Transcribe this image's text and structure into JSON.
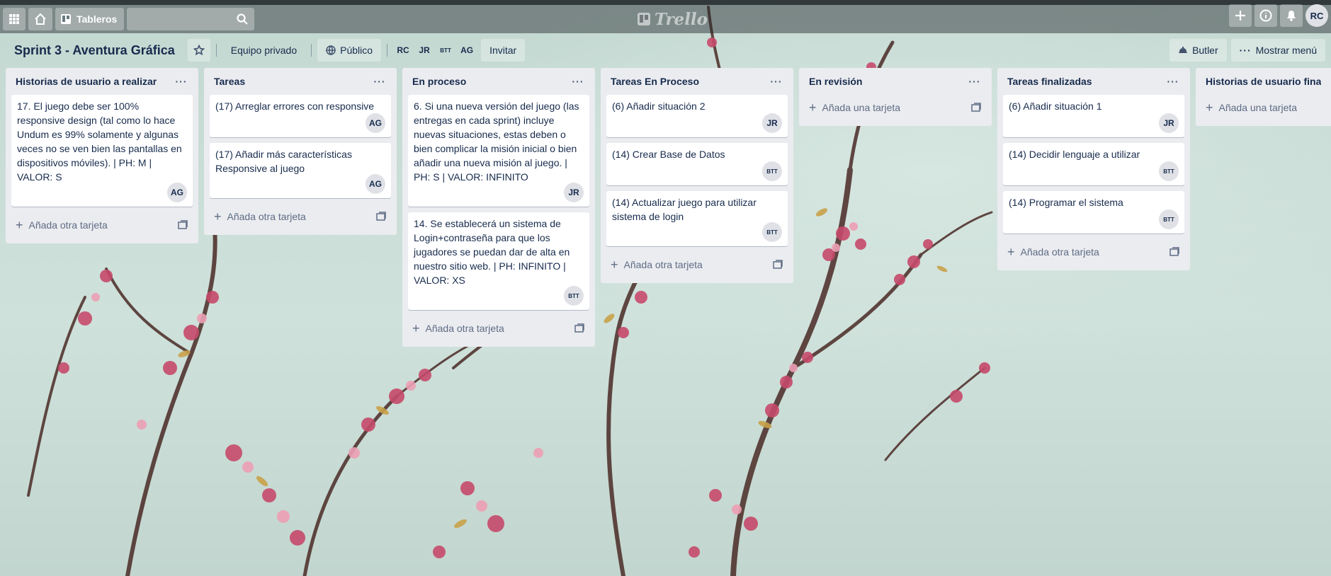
{
  "colors": {
    "header_bg": "rgba(34,40,44,0.46)",
    "list_bg": "#ebecf0",
    "card_bg": "#ffffff",
    "text": "#172b4d",
    "muted": "#5e6c84",
    "avatar_bg": "#dfe1e6"
  },
  "top_header": {
    "apps_icon": "grid-icon",
    "home_icon": "home-icon",
    "boards_label": "Tableros",
    "search_placeholder": "",
    "logo_text": "Trello",
    "add_icon": "plus-icon",
    "info_icon": "info-icon",
    "notifications_icon": "bell-icon",
    "user_initials": "RC"
  },
  "board_header": {
    "title": "Sprint 3 - Aventura Gráfica",
    "team_label": "Equipo privado",
    "visibility_label": "Público",
    "members": [
      "RC",
      "JR",
      "BTT",
      "AG"
    ],
    "invite_label": "Invitar",
    "butler_label": "Butler",
    "menu_label": "Mostrar menú"
  },
  "lists": [
    {
      "title": "Historias de usuario a realizar",
      "cards": [
        {
          "text": "17. El juego debe ser 100% responsive design (tal como lo hace Undum es 99% solamente y algunas veces no se ven bien las pantallas en dispositivos móviles). | PH: M | VALOR: S",
          "member": "AG"
        }
      ],
      "add_label": "Añada otra tarjeta"
    },
    {
      "title": "Tareas",
      "cards": [
        {
          "text": "(17) Arreglar errores con responsive",
          "member": "AG"
        },
        {
          "text": "(17) Añadir más características Responsive al juego",
          "member": "AG"
        }
      ],
      "add_label": "Añada otra tarjeta"
    },
    {
      "title": "En proceso",
      "cards": [
        {
          "text": "6. Si una nueva versión del juego (las entregas en cada sprint) incluye nuevas situaciones, estas deben o bien complicar la misión inicial o bien añadir una nueva misión al juego. | PH: S | VALOR: INFINITO",
          "member": "JR"
        },
        {
          "text": "14. Se establecerá un sistema de Login+contraseña para que los jugadores se puedan dar de alta en nuestro sitio web. | PH: INFINITO | VALOR: XS",
          "member": "BTT"
        }
      ],
      "add_label": "Añada otra tarjeta"
    },
    {
      "title": "Tareas En Proceso",
      "cards": [
        {
          "text": "(6) Añadir situación 2",
          "member": "JR"
        },
        {
          "text": "(14) Crear Base de Datos",
          "member": "BTT"
        },
        {
          "text": "(14) Actualizar juego para utilizar sistema de login",
          "member": "BTT"
        }
      ],
      "add_label": "Añada otra tarjeta"
    },
    {
      "title": "En revisión",
      "cards": [],
      "add_label": "Añada una tarjeta"
    },
    {
      "title": "Tareas finalizadas",
      "cards": [
        {
          "text": "(6) Añadir situación 1",
          "member": "JR"
        },
        {
          "text": "(14) Decidir lenguaje a utilizar",
          "member": "BTT"
        },
        {
          "text": "(14) Programar el sistema",
          "member": "BTT"
        }
      ],
      "add_label": "Añada otra tarjeta"
    },
    {
      "title": "Historias de usuario finalizadas",
      "cards": [],
      "add_label": "Añada una tarjeta"
    }
  ]
}
